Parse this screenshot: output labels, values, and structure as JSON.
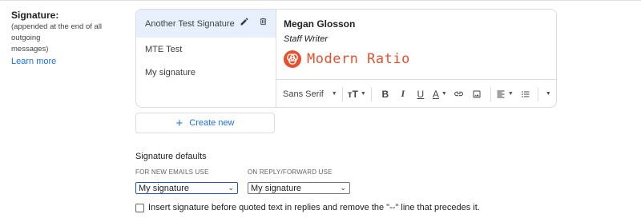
{
  "section": {
    "title": "Signature:",
    "subtitle_line1": "(appended at the end of all outgoing",
    "subtitle_line2": "messages)",
    "learn_more": "Learn more"
  },
  "signatures": [
    {
      "label": "Another Test Signature",
      "active": true
    },
    {
      "label": "MTE Test",
      "active": false
    },
    {
      "label": "My signature",
      "active": false
    }
  ],
  "editor": {
    "name": "Megan Glosson",
    "role": "Staff Writer",
    "logo_text": "Modern Ratio",
    "logo_color": "#ea4f2b",
    "toolbar": {
      "font": "Sans Serif",
      "buttons": [
        "text-size-icon",
        "bold-icon",
        "italic-icon",
        "underline-icon",
        "text-color-icon",
        "link-icon",
        "image-icon",
        "align-icon",
        "bulleted-list-icon",
        "more-icon"
      ]
    }
  },
  "create_new": "Create new",
  "defaults": {
    "title": "Signature defaults",
    "new_emails_label": "FOR NEW EMAILS USE",
    "new_emails_value": "My signature",
    "reply_label": "ON REPLY/FORWARD USE",
    "reply_value": "My signature"
  },
  "insert_before_quoted": "Insert signature before quoted text in replies and remove the \"--\" line that precedes it.",
  "colors": {
    "accent": "#1a73e8",
    "active_row": "#e8f0fe"
  }
}
